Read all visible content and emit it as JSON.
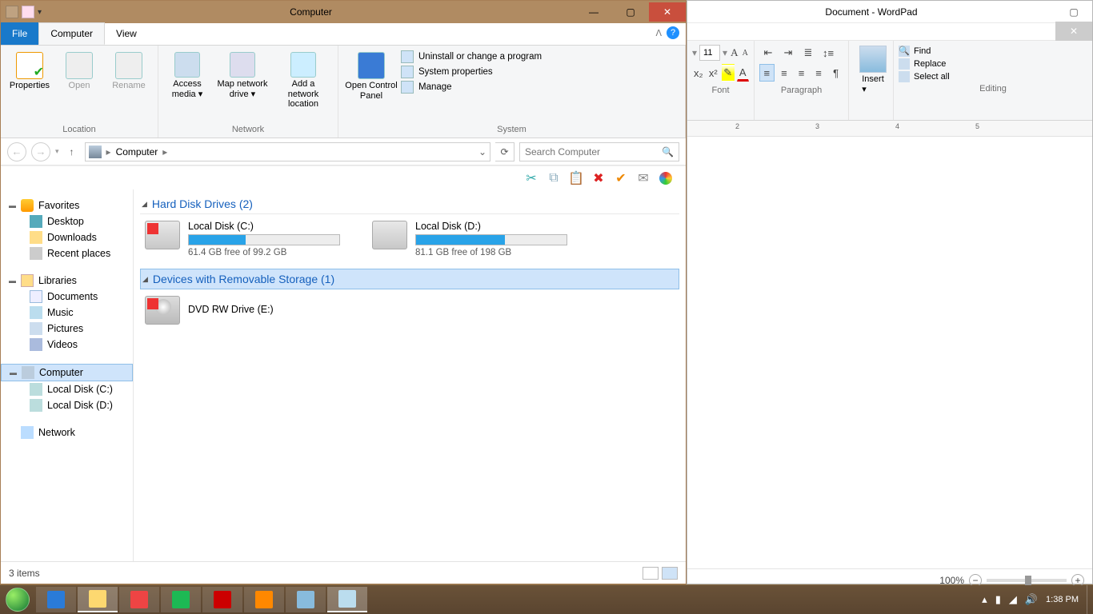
{
  "explorer": {
    "title": "Computer",
    "tabs": {
      "file": "File",
      "computer": "Computer",
      "view": "View"
    },
    "ribbon": {
      "location": {
        "label": "Location",
        "properties": "Properties",
        "open": "Open",
        "rename": "Rename"
      },
      "network": {
        "label": "Network",
        "access_media": "Access media",
        "map_drive": "Map network drive",
        "add_location": "Add a network location"
      },
      "system": {
        "label": "System",
        "open_cp": "Open Control Panel",
        "uninstall": "Uninstall or change a program",
        "sysprops": "System properties",
        "manage": "Manage"
      }
    },
    "address": {
      "location": "Computer"
    },
    "search_placeholder": "Search Computer",
    "nav": {
      "favorites": "Favorites",
      "desktop": "Desktop",
      "downloads": "Downloads",
      "recent": "Recent places",
      "libraries": "Libraries",
      "documents": "Documents",
      "music": "Music",
      "pictures": "Pictures",
      "videos": "Videos",
      "computer": "Computer",
      "disk_c": "Local Disk (C:)",
      "disk_d": "Local Disk (D:)",
      "network": "Network"
    },
    "categories": {
      "hdd": "Hard Disk Drives (2)",
      "removable": "Devices with Removable Storage (1)"
    },
    "drives": {
      "c": {
        "name": "Local Disk (C:)",
        "space": "61.4 GB free of 99.2 GB",
        "fill_pct": 38
      },
      "d": {
        "name": "Local Disk (D:)",
        "space": "81.1 GB free of 198 GB",
        "fill_pct": 59
      },
      "dvd": {
        "name": "DVD RW Drive (E:)"
      }
    },
    "status": "3 items"
  },
  "wordpad": {
    "title": "Document - WordPad",
    "font_size": "11",
    "groups": {
      "font": "Font",
      "paragraph": "Paragraph",
      "insert": "Insert",
      "editing": "Editing"
    },
    "insert_label": "Insert",
    "editing": {
      "find": "Find",
      "replace": "Replace",
      "select_all": "Select all"
    },
    "zoom": "100%",
    "ruler_marks": [
      "2",
      "3",
      "4",
      "5"
    ]
  },
  "taskbar": {
    "time": "1:38 PM"
  }
}
